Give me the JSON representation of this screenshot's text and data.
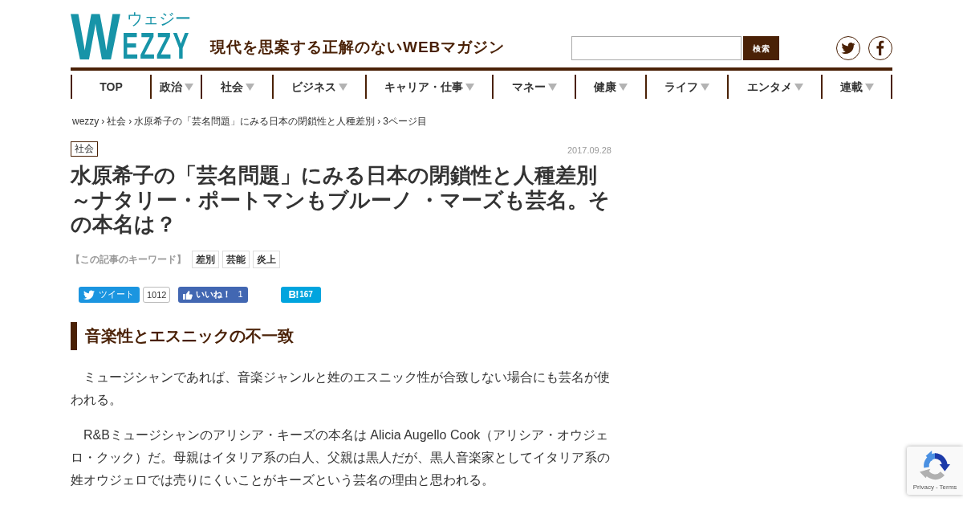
{
  "header": {
    "logo": {
      "initial": "W",
      "rest": "EZZY",
      "kana": "ウェジー"
    },
    "tagline": "現代を思案する正解のないWEBマガジン",
    "search": {
      "button": "検索"
    }
  },
  "nav": [
    {
      "label": "TOP",
      "dropdown": false
    },
    {
      "label": "政治",
      "dropdown": true
    },
    {
      "label": "社会",
      "dropdown": true
    },
    {
      "label": "ビジネス",
      "dropdown": true
    },
    {
      "label": "キャリア・仕事",
      "dropdown": true
    },
    {
      "label": "マネー",
      "dropdown": true
    },
    {
      "label": "健康",
      "dropdown": true
    },
    {
      "label": "ライフ",
      "dropdown": true
    },
    {
      "label": "エンタメ",
      "dropdown": true
    },
    {
      "label": "連載",
      "dropdown": true
    }
  ],
  "breadcrumb": [
    {
      "label": "wezzy"
    },
    {
      "sep": "›",
      "label": "社会"
    },
    {
      "sep": "›",
      "label": "水原希子の「芸名問題」にみる日本の閉鎖性と人種差別"
    },
    {
      "sep": "›",
      "label": "3ページ目"
    }
  ],
  "article": {
    "category": "社会",
    "date": "2017.09.28",
    "title": "水原希子の「芸名問題」にみる日本の閉鎖性と人種差別～ナタリー・ポートマンもブルーノ ・マーズも芸名。その本名は？",
    "keywords": {
      "label": "【この記事のキーワード】",
      "tags": [
        "差別",
        "芸能",
        "炎上"
      ]
    },
    "share": {
      "tweet": {
        "label": "ツイート",
        "count": "1012"
      },
      "like": {
        "label": "いいね！",
        "count": "1"
      },
      "bookmark": {
        "logo": "B!",
        "count": "167"
      }
    },
    "section_heading": "音楽性とエスニックの不一致",
    "paragraphs": [
      "ミュージシャンであれば、音楽ジャンルと姓のエスニック性が合致しない場合にも芸名が使われる。",
      "R&Bミュージシャンのアリシア・キーズの本名は Alicia Augello Cook（アリシア・オウジェロ・クック）だ。母親はイタリア系の白人、父親は黒人だが、黒人音楽家としてイタリア系の姓オウジェロでは売りにくいことがキーズという芸名の理由と思われる。"
    ]
  },
  "recaptcha": {
    "links": [
      {
        "label": "Privacy"
      },
      {
        "sep": "-",
        "label": "Terms"
      }
    ]
  }
}
